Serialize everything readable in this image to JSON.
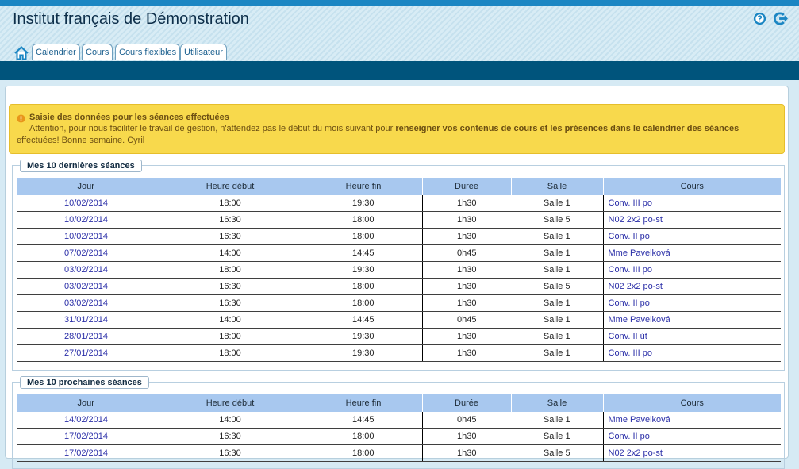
{
  "app": {
    "title": "Institut français de Démonstration"
  },
  "header_icons": [
    {
      "name": "help-icon",
      "color": "#1b86c3"
    },
    {
      "name": "logout-icon",
      "color": "#1b86c3"
    }
  ],
  "nav": {
    "home_icon": "home-icon",
    "tabs": [
      {
        "label": "Calendrier"
      },
      {
        "label": "Cours"
      },
      {
        "label": "Cours flexibles"
      },
      {
        "label": "Utilisateur"
      }
    ]
  },
  "alert": {
    "title": "Saisie des données pour les séances effectuées",
    "body_start": "Attention, pour nous faciliter le travail de gestion, n'attendez pas le début du mois suivant pour ",
    "body_bold": "renseigner vos contenus de cours et les présences dans le calendrier des séances",
    "body_end": " effectuées! Bonne semaine. Cyril"
  },
  "columns": [
    "Jour",
    "Heure début",
    "Heure fin",
    "Durée",
    "Salle",
    "Cours"
  ],
  "last_sessions": {
    "title": "Mes 10 dernières séances",
    "rows": [
      [
        "10/02/2014",
        "18:00",
        "19:30",
        "1h30",
        "Salle 1",
        "Conv. III po"
      ],
      [
        "10/02/2014",
        "16:30",
        "18:00",
        "1h30",
        "Salle 5",
        "N02 2x2 po-st"
      ],
      [
        "10/02/2014",
        "16:30",
        "18:00",
        "1h30",
        "Salle 1",
        "Conv. II po"
      ],
      [
        "07/02/2014",
        "14:00",
        "14:45",
        "0h45",
        "Salle 1",
        "Mme Pavelková"
      ],
      [
        "03/02/2014",
        "18:00",
        "19:30",
        "1h30",
        "Salle 1",
        "Conv. III po"
      ],
      [
        "03/02/2014",
        "16:30",
        "18:00",
        "1h30",
        "Salle 5",
        "N02 2x2 po-st"
      ],
      [
        "03/02/2014",
        "16:30",
        "18:00",
        "1h30",
        "Salle 1",
        "Conv. II po"
      ],
      [
        "31/01/2014",
        "14:00",
        "14:45",
        "0h45",
        "Salle 1",
        "Mme Pavelková"
      ],
      [
        "28/01/2014",
        "18:00",
        "19:30",
        "1h30",
        "Salle 1",
        "Conv. II út"
      ],
      [
        "27/01/2014",
        "18:00",
        "19:30",
        "1h30",
        "Salle 1",
        "Conv. III po"
      ]
    ]
  },
  "next_sessions": {
    "title": "Mes 10 prochaines séances",
    "rows": [
      [
        "14/02/2014",
        "14:00",
        "14:45",
        "0h45",
        "Salle 1",
        "Mme Pavelková"
      ],
      [
        "17/02/2014",
        "16:30",
        "18:00",
        "1h30",
        "Salle 1",
        "Conv. II po"
      ],
      [
        "17/02/2014",
        "16:30",
        "18:00",
        "1h30",
        "Salle 5",
        "N02 2x2 po-st"
      ]
    ]
  }
}
